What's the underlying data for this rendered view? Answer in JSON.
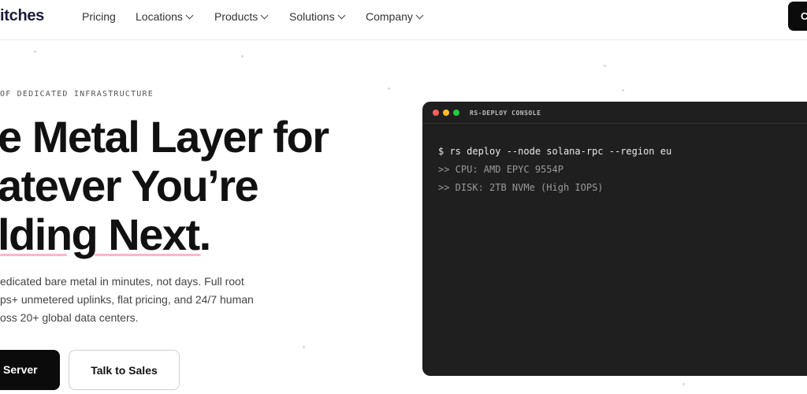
{
  "header": {
    "logo_text": "itches",
    "nav": [
      {
        "label": "Pricing",
        "has_dropdown": false
      },
      {
        "label": "Locations",
        "has_dropdown": true
      },
      {
        "label": "Products",
        "has_dropdown": true
      },
      {
        "label": "Solutions",
        "has_dropdown": true
      },
      {
        "label": "Company",
        "has_dropdown": true
      }
    ],
    "cta_label": "C"
  },
  "hero": {
    "eyebrow": "OF DEDICATED INFRASTRUCTURE",
    "headline": [
      "e Metal Layer for",
      "atever You’re",
      "lding Next."
    ],
    "description": [
      "edicated bare metal in minutes, not days. Full root",
      "ps+ unmetered uplinks, flat pricing, and 24/7 human",
      "oss 20+ global data centers."
    ],
    "primary_button": "Server",
    "secondary_button": "Talk to Sales",
    "accent_color": "#f6b8cf"
  },
  "console": {
    "title": "RS-DEPLOY CONSOLE",
    "lines": [
      {
        "text": "$ rs deploy --node solana-rpc --region eu",
        "kind": "command"
      },
      {
        "text": ">> CPU: AMD EPYC 9554P",
        "kind": "output"
      },
      {
        "text": ">> DISK: 2TB NVMe (High IOPS)",
        "kind": "output"
      }
    ],
    "traffic_lights": [
      "#ff5f57",
      "#febc2e",
      "#28c840"
    ]
  }
}
